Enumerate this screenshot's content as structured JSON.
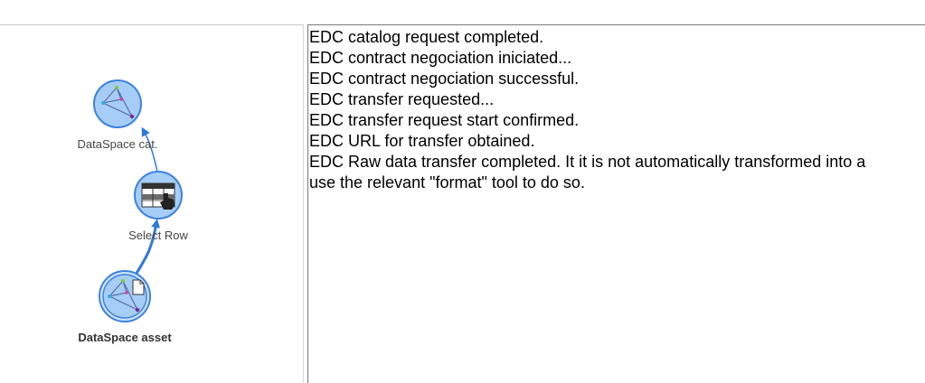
{
  "workflow": {
    "nodes": [
      {
        "id": "dataspace-catalog",
        "label": "DataSpace cat.",
        "icon": "dataspace-icon",
        "selected": false
      },
      {
        "id": "select-row",
        "label": "Select Row",
        "icon": "select-row-table-icon",
        "selected": false
      },
      {
        "id": "dataspace-asset",
        "label": "DataSpace asset",
        "icon": "dataspace-asset-icon",
        "selected": true
      }
    ],
    "edges": [
      {
        "from": "dataspace-asset",
        "to": "select-row"
      },
      {
        "from": "select-row",
        "to": "dataspace-catalog"
      }
    ],
    "colors": {
      "node_fill": "#a6cdf5",
      "node_stroke": "#3b82e0",
      "edge": "#2f7ad8",
      "selected_fill": "#cfe3f8"
    }
  },
  "log": {
    "lines": [
      "EDC catalog request completed.",
      "EDC contract negociation iniciated...",
      "EDC contract negociation successful.",
      "EDC transfer requested...",
      "EDC transfer request start confirmed.",
      "EDC URL for transfer obtained.",
      "EDC Raw data transfer completed. It it is not automatically transformed into a",
      "use the relevant \"format\" tool to do so."
    ]
  }
}
